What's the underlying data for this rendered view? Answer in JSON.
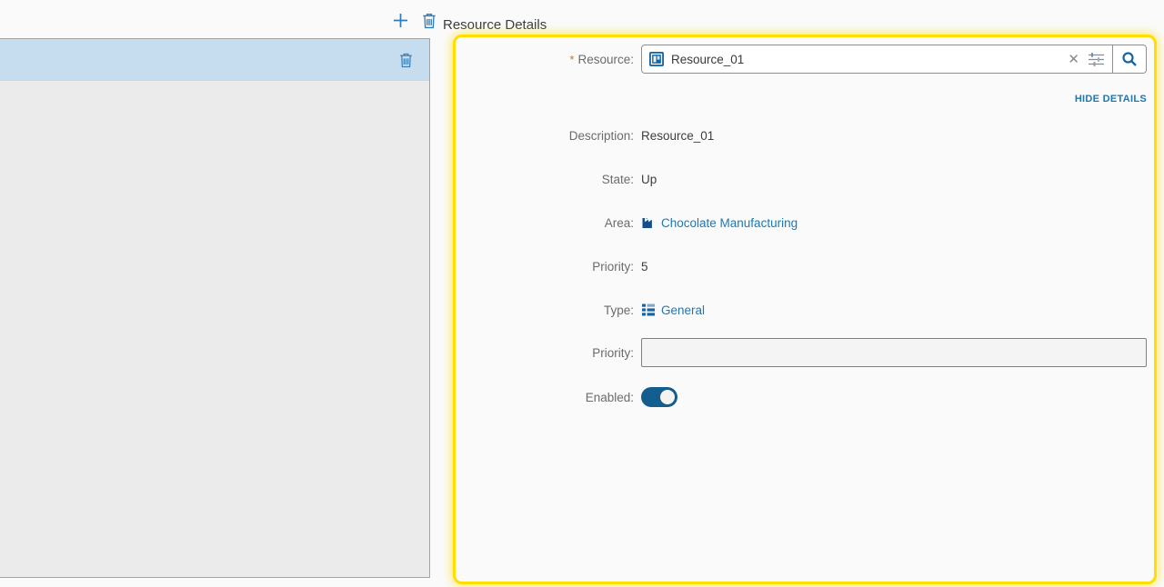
{
  "toolbar": {
    "title": "Resource Details"
  },
  "details": {
    "hide_details_label": "HIDE DETAILS",
    "resource": {
      "required_marker": "*",
      "label": "Resource:",
      "value": "Resource_01"
    },
    "description": {
      "label": "Description:",
      "value": "Resource_01"
    },
    "state": {
      "label": "State:",
      "value": "Up"
    },
    "area": {
      "label": "Area:",
      "value": "Chocolate Manufacturing"
    },
    "priority": {
      "label": "Priority:",
      "value": "5"
    },
    "type": {
      "label": "Type:",
      "value": "General"
    },
    "priority_input": {
      "label": "Priority:",
      "value": "",
      "placeholder": ""
    },
    "enabled": {
      "label": "Enabled:",
      "state": "on"
    }
  },
  "colors": {
    "highlight_border": "#ffdf00",
    "accent_blue": "#1b79b3",
    "list_header_bg": "#c6ddf0",
    "toggle_on": "#135e8e"
  }
}
